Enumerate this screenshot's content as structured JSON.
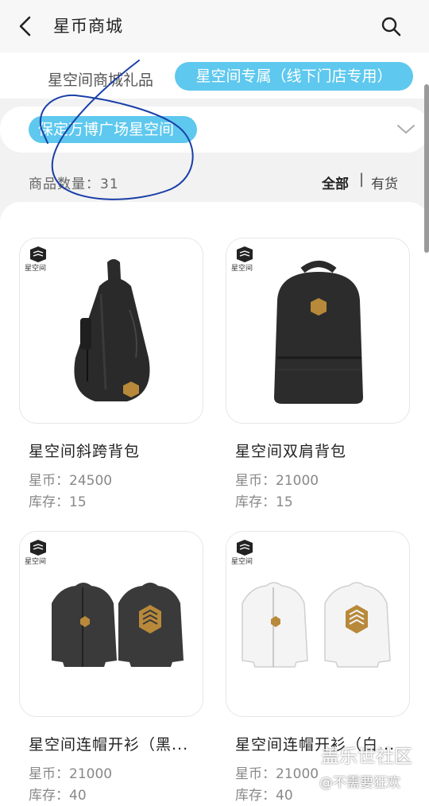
{
  "header": {
    "title": "星币商城",
    "back_icon": "back-arrow-icon",
    "search_icon": "search-icon"
  },
  "tabs": [
    {
      "label": "星空间商城礼品",
      "active": false
    },
    {
      "label": "星空间专属（线下门店专用）",
      "active": true
    }
  ],
  "store_selector": {
    "selected": "保定万博广场星空间"
  },
  "summary": {
    "count_label": "商品数量：31",
    "filter_all": "全部",
    "filter_sep": "|",
    "filter_stock": "有货"
  },
  "logo_text": "星空间",
  "products": [
    {
      "name": "星空间斜跨背包",
      "price": "星币：24500",
      "stock": "库存：15"
    },
    {
      "name": "星空间双肩背包",
      "price": "星币：21000",
      "stock": "库存：15"
    },
    {
      "name": "星空间连帽开衫（黑...",
      "price": "星币：21000",
      "stock": "库存：40"
    },
    {
      "name": "星空间连帽开衫（白...",
      "price": "星币：21000",
      "stock": "库存：40"
    }
  ],
  "watermark": {
    "line1": "盖乐世社区",
    "line2": "@不需要狂欢"
  },
  "colors": {
    "accent": "#5ec8ee",
    "background": "#f2f2f2",
    "ink": "#1a3fa8"
  }
}
